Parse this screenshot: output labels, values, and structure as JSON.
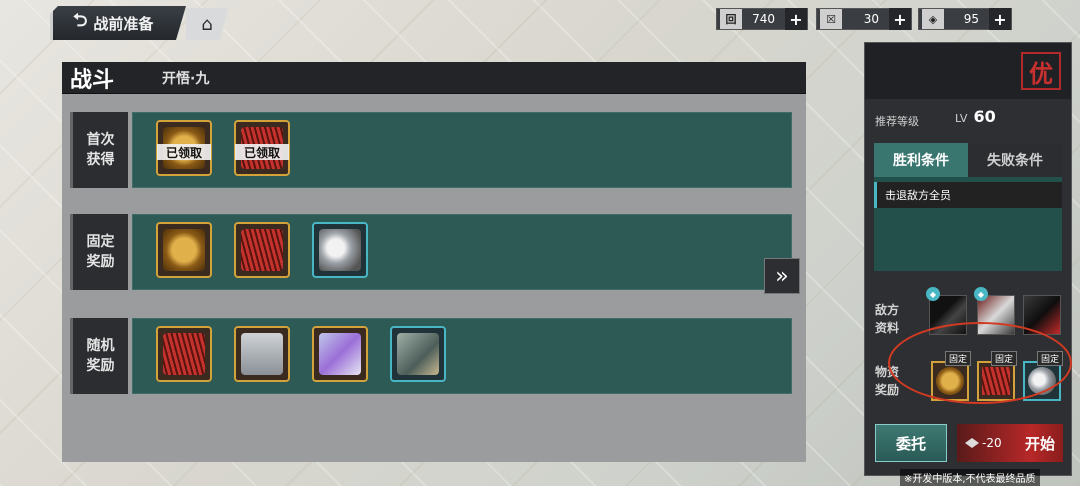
{
  "topbar": {
    "back_label": "战前准备",
    "resources": [
      {
        "icon": "ticket-icon",
        "value": "740"
      },
      {
        "icon": "energy-icon",
        "value": "30"
      },
      {
        "icon": "crystal-icon",
        "value": "95"
      }
    ]
  },
  "main": {
    "title": "战斗",
    "stage_name": "开悟·九",
    "rows": [
      {
        "label": "首次获得",
        "items": [
          {
            "icon": "copper-coin-icon",
            "claimed": "已领取"
          },
          {
            "icon": "red-fan-icon",
            "claimed": "已领取"
          }
        ]
      },
      {
        "label": "固定奖励",
        "items": [
          {
            "icon": "copper-coin-icon"
          },
          {
            "icon": "red-fan-icon"
          },
          {
            "icon": "silver-coin-icon"
          }
        ]
      },
      {
        "label": "随机奖励",
        "items": [
          {
            "icon": "red-fan-icon"
          },
          {
            "icon": "cloth-bundle-icon"
          },
          {
            "icon": "crystal-cube-icon"
          },
          {
            "icon": "scroll-icon"
          }
        ]
      }
    ]
  },
  "side": {
    "rank": "优",
    "recommend_label": "推荐等级",
    "lv_prefix": "LV",
    "lv_value": "60",
    "tab_win": "胜利条件",
    "tab_lose": "失败条件",
    "condition": "击退敌方全员",
    "enemy_label": "敌方资料",
    "reward_label": "物资奖励",
    "fixed_tag": "固定",
    "entrust_label": "委托",
    "cost": "-20",
    "start_label": "开始",
    "disclaimer": "※开发中版本,不代表最终品质"
  }
}
